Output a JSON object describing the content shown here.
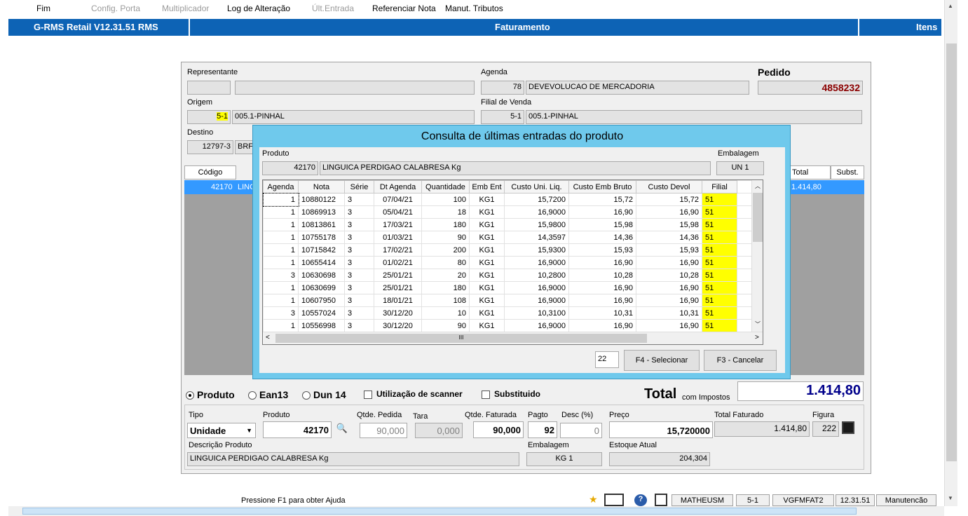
{
  "menu": [
    {
      "label": "Fim",
      "enabled": true
    },
    {
      "label": "Config. Porta",
      "enabled": false
    },
    {
      "label": "Multiplicador",
      "enabled": false
    },
    {
      "label": "Log de Alteração",
      "enabled": true
    },
    {
      "label": "Últ.Entrada",
      "enabled": false
    },
    {
      "label": "Referenciar Nota",
      "enabled": true
    },
    {
      "label": "Manut. Tributos",
      "enabled": true
    }
  ],
  "titlebar": {
    "app": "G-RMS Retail V12.31.51 RMS",
    "center": "Faturamento",
    "right": "Itens"
  },
  "header": {
    "representante_label": "Representante",
    "agenda_label": "Agenda",
    "agenda_code": "78",
    "agenda_desc": "DEVEVOLUCAO DE  MERCADORIA",
    "pedido_label": "Pedido",
    "pedido_value": "4858232",
    "origem_label": "Origem",
    "origem_code": "5-1",
    "origem_desc": "005.1-PINHAL",
    "filial_label": "Filial de Venda",
    "filial_code": "5-1",
    "filial_desc": "005.1-PINHAL",
    "destino_label": "Destino",
    "destino_code": "12797-3",
    "destino_desc": "BRF"
  },
  "main_grid": {
    "col_codigo": "Código",
    "col_total": "Total",
    "col_subst": "Subst.",
    "row_codigo": "42170",
    "row_desc": "LING",
    "row_total": "1.414,80"
  },
  "modal": {
    "title": "Consulta de últimas entradas do produto",
    "produto_label": "Produto",
    "produto_code": "42170",
    "produto_desc": "LINGUICA PERDIGAO CALABRESA Kg",
    "embalagem_label": "Embalagem",
    "embalagem_value": "UN  1",
    "columns": [
      "Agenda",
      "Nota",
      "Série",
      "Dt Agenda",
      "Quantidade",
      "Emb Ent",
      "Custo Uni. Liq.",
      "Custo Emb Bruto",
      "Custo Devol",
      "Filial"
    ],
    "rows": [
      [
        "1",
        "10880122",
        "3",
        "07/04/21",
        "100",
        "KG1",
        "15,7200",
        "15,72",
        "15,72",
        "51"
      ],
      [
        "1",
        "10869913",
        "3",
        "05/04/21",
        "18",
        "KG1",
        "16,9000",
        "16,90",
        "16,90",
        "51"
      ],
      [
        "1",
        "10813861",
        "3",
        "17/03/21",
        "180",
        "KG1",
        "15,9800",
        "15,98",
        "15,98",
        "51"
      ],
      [
        "1",
        "10755178",
        "3",
        "01/03/21",
        "90",
        "KG1",
        "14,3597",
        "14,36",
        "14,36",
        "51"
      ],
      [
        "1",
        "10715842",
        "3",
        "17/02/21",
        "200",
        "KG1",
        "15,9300",
        "15,93",
        "15,93",
        "51"
      ],
      [
        "1",
        "10655414",
        "3",
        "01/02/21",
        "80",
        "KG1",
        "16,9000",
        "16,90",
        "16,90",
        "51"
      ],
      [
        "3",
        "10630698",
        "3",
        "25/01/21",
        "20",
        "KG1",
        "10,2800",
        "10,28",
        "10,28",
        "51"
      ],
      [
        "1",
        "10630699",
        "3",
        "25/01/21",
        "180",
        "KG1",
        "16,9000",
        "16,90",
        "16,90",
        "51"
      ],
      [
        "1",
        "10607950",
        "3",
        "18/01/21",
        "108",
        "KG1",
        "16,9000",
        "16,90",
        "16,90",
        "51"
      ],
      [
        "3",
        "10557024",
        "3",
        "30/12/20",
        "10",
        "KG1",
        "10,3100",
        "10,31",
        "10,31",
        "51"
      ],
      [
        "1",
        "10556998",
        "3",
        "30/12/20",
        "90",
        "KG1",
        "16,9000",
        "16,90",
        "16,90",
        "51"
      ]
    ],
    "count_value": "22",
    "select_button": "F4 - Selecionar",
    "cancel_button": "F3 - Cancelar",
    "hscroll_glyph": "III"
  },
  "options": {
    "radio_produto": "Produto",
    "radio_ean13": "Ean13",
    "radio_dun14": "Dun 14",
    "chk_scanner": "Utilização de scanner",
    "chk_subst": "Substituido",
    "total_label": "Total",
    "total_sub": "com Impostos",
    "total_value": "1.414,80"
  },
  "item": {
    "tipo_label": "Tipo",
    "tipo_value": "Unidade",
    "produto_label": "Produto",
    "produto_value": "42170",
    "qtde_pedida_label": "Qtde. Pedida",
    "qtde_pedida_value": "90,000",
    "tara_label": "Tara",
    "tara_value": "0,000",
    "qtde_faturada_label": "Qtde. Faturada",
    "qtde_faturada_value": "90,000",
    "pagto_label": "Pagto",
    "pagto_value": "92",
    "desc_label": "Desc (%)",
    "desc_value": "0",
    "preco_label": "Preço",
    "preco_value": "15,720000",
    "total_faturado_label": "Total Faturado",
    "total_faturado_value": "1.414,80",
    "figura_label": "Figura",
    "figura_value": "222",
    "descricao_label": "Descrição Produto",
    "descricao_value": "LINGUICA PERDIGAO CALABRESA Kg",
    "embalagem_label": "Embalagem",
    "embalagem_value": "KG  1",
    "estoque_label": "Estoque Atual",
    "estoque_value": "204,304"
  },
  "statusbar": {
    "help": "Pressione F1 para obter Ajuda",
    "user": "MATHEUSM",
    "filial": "5-1",
    "program": "VGFMFAT2",
    "version": "12.31.51",
    "mode": "Manutencão"
  },
  "colors": {
    "title_blue": "#0d63b5",
    "modal_blue": "#6fc9ec",
    "highlight": "#ffff00",
    "pedido_red": "#8b0000",
    "total_navy": "#00008b"
  }
}
